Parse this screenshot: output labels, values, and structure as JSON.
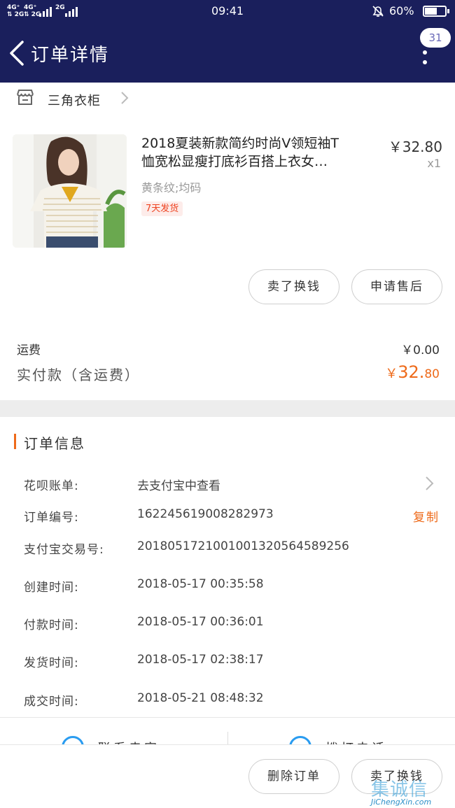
{
  "status_bar": {
    "signal1": "4G⁺\n2G",
    "signal2": "4G⁺\n2G",
    "signal3": "2G",
    "time": "09:41",
    "battery": "60%",
    "battery_level": 0.6
  },
  "nav": {
    "title": "订单详情",
    "badge": "31"
  },
  "shop": {
    "name": "三角衣柜"
  },
  "product": {
    "title_line1": "2018夏装新款简约时尚V领短袖T",
    "title_line2": "恤宽松显瘦打底衫百搭上衣女…",
    "price": "￥32.80",
    "qty": "x1",
    "sku": "黄条纹;均码",
    "tag": "7天发货"
  },
  "actions": {
    "sell": "卖了换钱",
    "after_sale": "申请售后",
    "delete": "删除订单",
    "sell_bottom": "卖了换钱"
  },
  "fees": {
    "shipping_label": "运费",
    "shipping_value": "￥0.00",
    "paid_label": "实付款（含运费）",
    "paid_currency": "￥",
    "paid_int": "32.",
    "paid_dec": "80"
  },
  "order_info": {
    "title": "订单信息",
    "rows": [
      {
        "label": "花呗账单:",
        "value": "去支付宝中查看"
      },
      {
        "label": "订单编号:",
        "value": "162245619008282973"
      },
      {
        "label": "支付宝交易号:",
        "value": "2018051721001001320564589256"
      },
      {
        "label": "创建时间:",
        "value": "2018-05-17 00:35:58"
      },
      {
        "label": "付款时间:",
        "value": "2018-05-17 00:36:01"
      },
      {
        "label": "发货时间:",
        "value": "2018-05-17 02:38:17"
      },
      {
        "label": "成交时间:",
        "value": "2018-05-21 08:48:32"
      }
    ],
    "copy": "复制"
  },
  "peek": {
    "left": "联系卖家",
    "right": "拨打电话"
  },
  "watermark": {
    "cn": "集诚信",
    "en": "JiChengXin.com"
  }
}
